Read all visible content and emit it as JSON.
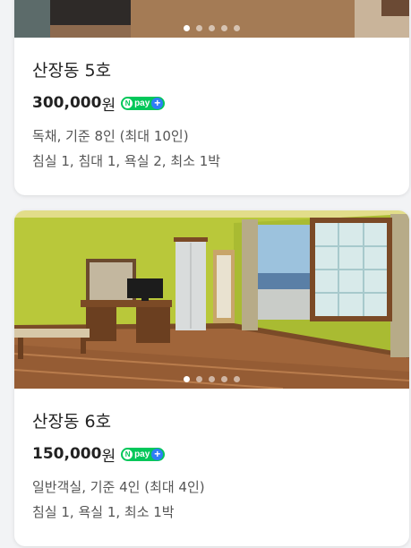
{
  "rooms": [
    {
      "name": "산장동 5호",
      "price": "300,000",
      "currency": "원",
      "pay_badge": "pay",
      "type_line": "독채, 기준 8인 (최대 10인)",
      "facility_line": "침실 1, 침대 1, 욕실 2, 최소 1박",
      "carousel_total": 5,
      "carousel_active": 1
    },
    {
      "name": "산장동 6호",
      "price": "150,000",
      "currency": "원",
      "pay_badge": "pay",
      "type_line": "일반객실, 기준 4인 (최대 4인)",
      "facility_line": "침실 1, 욕실 1, 최소 1박",
      "carousel_total": 5,
      "carousel_active": 1
    }
  ],
  "colors": {
    "npay_green": "#03c75a",
    "plus_blue": "#2f7df6",
    "wall_green": "#b9c83a",
    "floor_brown": "#a0653a"
  }
}
